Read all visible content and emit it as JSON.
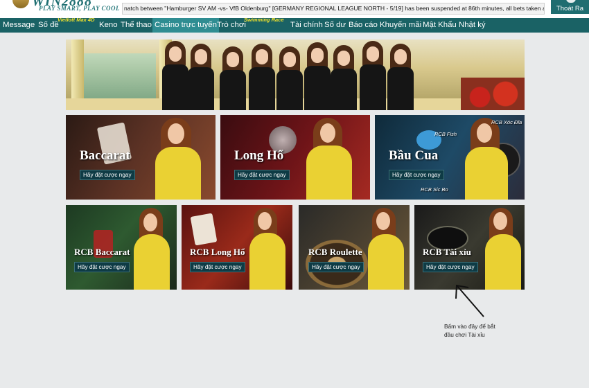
{
  "header": {
    "logo_text": "WIN2888",
    "logo_tagline": "PLAY SMART, PLAY COOL",
    "ticker_text": "natch between \"Hamburger SV AM -vs- VfB Oldenburg\" [GERMANY REGIONAL LEAGUE NORTH - 5/19] has been suspended at 86th minutes, all bets taken are cons",
    "logout_label": "Thoát Ra"
  },
  "nav": {
    "items": [
      {
        "label": "Message"
      },
      {
        "label": "Số đề",
        "sup": "Vietlott Max 4D"
      },
      {
        "label": "Keno"
      },
      {
        "label": "Thể thao"
      },
      {
        "label": "Casino trực tuyến",
        "active": true
      },
      {
        "label": "Trò chơi",
        "sup": "Swimming Race"
      },
      {
        "label": "Tài chính"
      },
      {
        "label": "Số dư"
      },
      {
        "label": "Báo cáo"
      },
      {
        "label": "Khuyến mãi"
      },
      {
        "label": "Mật Khẩu"
      },
      {
        "label": "Nhật ký"
      }
    ]
  },
  "games": {
    "play_label": "Hãy đặt cược ngay",
    "row1": [
      {
        "title": "Baccarat"
      },
      {
        "title": "Long Hổ"
      },
      {
        "title": "Bầu Cua",
        "tags": [
          "RCB Fish",
          "RCB Xóc Đĩa",
          "RCB Sic Bo"
        ]
      }
    ],
    "row2": [
      {
        "title": "RCB Baccarat"
      },
      {
        "title": "RCB Long Hổ"
      },
      {
        "title": "RCB Roulette"
      },
      {
        "title": "RCB Tài xỉu"
      }
    ]
  },
  "annotation": {
    "line1": "Bấm vào đây để bắt",
    "line2": "đầu chơi Tài xỉu"
  },
  "colors": {
    "nav_bg": "#1a6265",
    "nav_active": "#2f8d92",
    "button_bg": "#0e3b45",
    "model_dress": "#ead133"
  }
}
